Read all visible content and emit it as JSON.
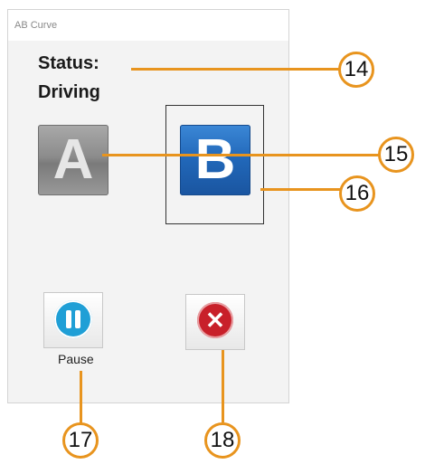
{
  "window": {
    "title": "AB Curve"
  },
  "status": {
    "label": "Status:",
    "value": "Driving"
  },
  "buttons": {
    "a_label": "A",
    "b_label": "B",
    "pause_label": "Pause",
    "cancel_glyph": "✕"
  },
  "callouts": [
    "14",
    "15",
    "16",
    "17",
    "18"
  ],
  "colors": {
    "callout": "#e8941e",
    "button_b": "#2167b8",
    "button_a": "#8c8c8c",
    "pause": "#1f9fd6",
    "cancel": "#c8202a"
  }
}
